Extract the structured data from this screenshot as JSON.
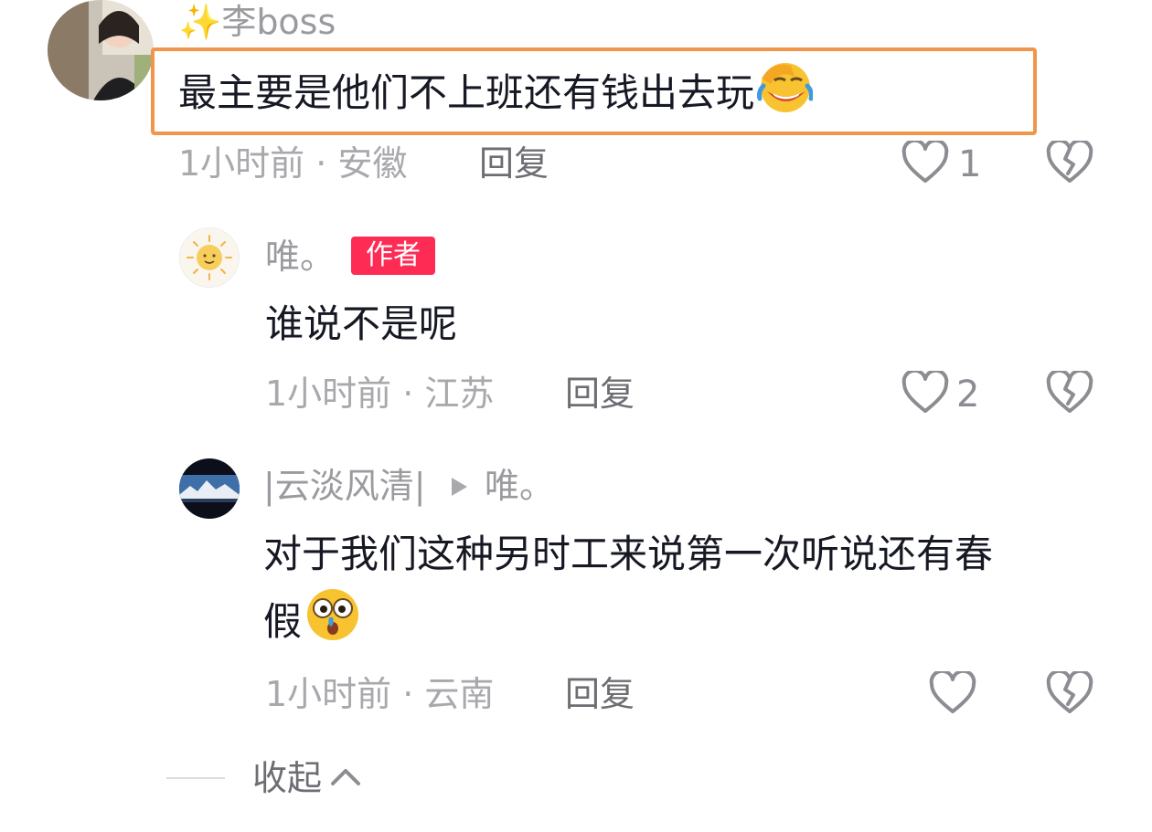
{
  "comments": [
    {
      "name": "✨李boss",
      "text": "最主要是他们不上班还有钱出去玩",
      "emoji": "laughing-crying-emoji",
      "meta": "1小时前 · 安徽",
      "reply_label": "回复",
      "like_count": "1"
    },
    {
      "name": "唯。",
      "author_badge": "作者",
      "text": "谁说不是呢",
      "meta": "1小时前 · 江苏",
      "reply_label": "回复",
      "like_count": "2"
    },
    {
      "name": "|云淡风清|",
      "reply_to": "唯。",
      "text_line1": "对于我们这种另时工来说第一次听说还有春",
      "text_line2": "假",
      "emoji": "shocked-crying-emoji",
      "meta": "1小时前 · 云南",
      "reply_label": "回复",
      "like_count": ""
    }
  ],
  "collapse_label": "收起",
  "colors": {
    "highlight_border": "#f0964a",
    "author_badge_bg": "#fe2c55",
    "text": "#161823",
    "muted": "#a8a8ad"
  }
}
